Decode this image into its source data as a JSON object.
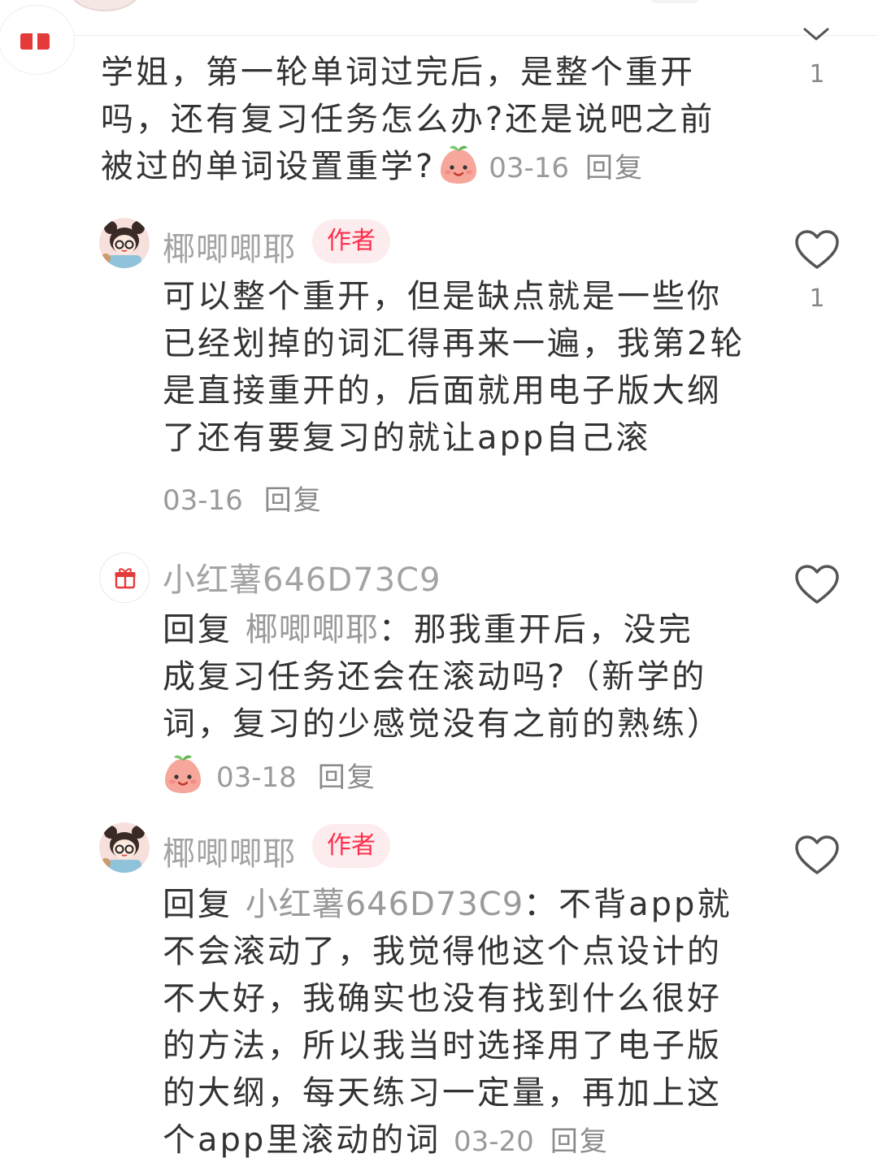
{
  "comments": [
    {
      "id": "c1",
      "text_lines": [
        "学姐，第一轮单词过完后，是整个重开",
        "吗，还有复习任务怎么办?还是说吧之前"
      ],
      "last_line": "被过的单词设置重学?",
      "emoji": "peach-smile-emoji",
      "date": "03-16",
      "reply_label": "回复",
      "like_count": "1"
    },
    {
      "id": "r1",
      "username": "椰唧唧耶",
      "badge": "作者",
      "text_lines": [
        "可以整个重开，但是缺点就是一些你",
        "已经划掉的词汇得再来一遍，我第2轮",
        "是直接重开的，后面就用电子版大纲",
        "了还有要复习的就让app自己滚"
      ],
      "date": "03-16",
      "reply_label": "回复",
      "like_count": "1"
    },
    {
      "id": "r2",
      "username": "小红薯646D73C9",
      "reply_prefix": "回复",
      "reply_target": "椰唧唧耶",
      "colon": "：",
      "first_line_rest": "那我重开后，没完",
      "text_lines": [
        "成复习任务还会在滚动吗?（新学的",
        "词，复习的少感觉没有之前的熟练）"
      ],
      "emoji": "peach-smile-emoji",
      "date": "03-18",
      "reply_label": "回复"
    },
    {
      "id": "r3",
      "username": "椰唧唧耶",
      "badge": "作者",
      "reply_prefix": "回复",
      "reply_target": "小红薯646D73C9",
      "colon": "：",
      "first_line_rest": "不背app就",
      "text_lines": [
        "不会滚动了，我觉得他这个点设计的",
        "不大好，我确实也没有找到什么很好",
        "的方法，所以我当时选择用了电子版",
        "的大纲，每天练习一定量，再加上这"
      ],
      "last_line": "个app里滚动的词",
      "date": "03-20",
      "reply_label": "回复"
    }
  ],
  "colors": {
    "badge_bg": "#fdeced",
    "badge_text": "#ff2e4d",
    "meta": "#9a9a9a",
    "text": "#333333"
  }
}
